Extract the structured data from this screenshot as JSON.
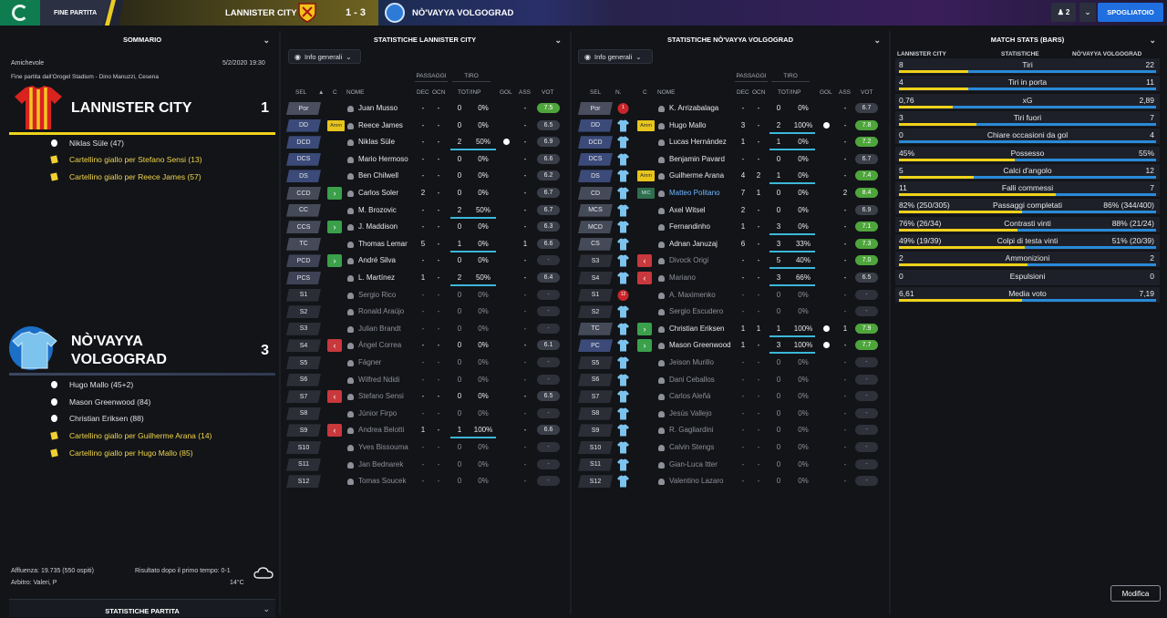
{
  "topbar": {
    "status": "FINE PARTITA",
    "home_team": "LANNISTER CITY",
    "score": "1 - 3",
    "away_team": "NÒ'VAYYA VOLGOGRAD",
    "user_count": "2",
    "spogliatoio": "SPOGLIATOIO",
    "colors": {
      "home_accent": "#e8cc25",
      "primary_button": "#1f6fe0"
    }
  },
  "summary": {
    "header": "SOMMARIO",
    "competition": "Amichevole",
    "datetime": "5/2/2020 19:30",
    "stadium": "Fine partita dall'Orogel Stadium - Dino Manuzzi, Cesena",
    "home": {
      "name": "LANNISTER CITY",
      "goals": "1",
      "events": [
        {
          "type": "goal",
          "text": "Niklas Süle (47)"
        },
        {
          "type": "yellow",
          "text": "Cartellino giallo per Stefano Sensi (13)"
        },
        {
          "type": "yellow",
          "text": "Cartellino giallo per Reece James (57)"
        }
      ]
    },
    "away": {
      "name_line1": "NÒ'VAYYA",
      "name_line2": "VOLGOGRAD",
      "goals": "3",
      "events": [
        {
          "type": "goal",
          "text": "Hugo Mallo (45+2)"
        },
        {
          "type": "goal",
          "text": "Mason Greenwood (84)"
        },
        {
          "type": "goal",
          "text": "Christian Eriksen (88)"
        },
        {
          "type": "yellow",
          "text": "Cartellino giallo per Guilherme Arana (14)"
        },
        {
          "type": "yellow",
          "text": "Cartellino giallo per Hugo Mallo (85)"
        }
      ]
    },
    "attendance": "Affluenza: 19.735 (550 ospiti)",
    "referee": "Arbitro: Valeri, P",
    "halftime": "Risultato dopo il primo tempo: 0-1",
    "temperature": "14°C",
    "bottom_section": "STATISTICHE PARTITA"
  },
  "home_stats": {
    "header": "STATISTICHE LANNISTER CITY",
    "filter": "Info generali",
    "groups": {
      "passaggi": "PASSAGGI",
      "tiro": "TIRO"
    },
    "columns": {
      "sel": "SEL",
      "c": "C",
      "nome": "NOME",
      "dec": "DEC",
      "ocn": "OCN",
      "totinp": "TOT/INP",
      "gol": "GOL",
      "ass": "ASS",
      "vot": "VOT"
    },
    "rows": [
      {
        "pos": "Por",
        "kind": "gk",
        "name": "Juan Musso",
        "sub": false,
        "dec": "-",
        "ocn": "-",
        "tot": "0",
        "pct": "0%",
        "gol": "",
        "ass": "-",
        "vot": "7.5",
        "vot_style": "green",
        "badge": ""
      },
      {
        "pos": "DD",
        "kind": "def",
        "name": "Reece James",
        "sub": false,
        "dec": "-",
        "ocn": "-",
        "tot": "0",
        "pct": "0%",
        "gol": "",
        "ass": "-",
        "vot": "6.5",
        "vot_style": "",
        "badge": "Amm"
      },
      {
        "pos": "DCD",
        "kind": "def",
        "name": "Niklas Süle",
        "sub": false,
        "dec": "-",
        "ocn": "-",
        "tot": "2",
        "pct": "50%",
        "gol": "ball",
        "ass": "-",
        "vot": "6.9",
        "vot_style": "",
        "badge": ""
      },
      {
        "pos": "DCS",
        "kind": "def",
        "name": "Mario Hermoso",
        "sub": false,
        "dec": "-",
        "ocn": "-",
        "tot": "0",
        "pct": "0%",
        "gol": "",
        "ass": "-",
        "vot": "6.6",
        "vot_style": "",
        "badge": ""
      },
      {
        "pos": "DS",
        "kind": "def",
        "name": "Ben Chilwell",
        "sub": false,
        "dec": "-",
        "ocn": "-",
        "tot": "0",
        "pct": "0%",
        "gol": "",
        "ass": "-",
        "vot": "6.2",
        "vot_style": "",
        "badge": ""
      },
      {
        "pos": "CCD",
        "kind": "mid",
        "name": "Carlos Soler",
        "sub": false,
        "dec": "2",
        "ocn": "-",
        "tot": "0",
        "pct": "0%",
        "gol": "",
        "ass": "-",
        "vot": "6.7",
        "vot_style": "",
        "badge": "in"
      },
      {
        "pos": "CC",
        "kind": "mid",
        "name": "M. Brozovic",
        "sub": false,
        "dec": "-",
        "ocn": "-",
        "tot": "2",
        "pct": "50%",
        "gol": "",
        "ass": "-",
        "vot": "6.7",
        "vot_style": "",
        "badge": ""
      },
      {
        "pos": "CCS",
        "kind": "mid",
        "name": "J. Maddison",
        "sub": false,
        "dec": "-",
        "ocn": "-",
        "tot": "0",
        "pct": "0%",
        "gol": "",
        "ass": "-",
        "vot": "6.3",
        "vot_style": "",
        "badge": "in"
      },
      {
        "pos": "TC",
        "kind": "mid",
        "name": "Thomas Lemar",
        "sub": false,
        "dec": "5",
        "ocn": "-",
        "tot": "1",
        "pct": "0%",
        "gol": "",
        "ass": "1",
        "vot": "6.6",
        "vot_style": "",
        "badge": ""
      },
      {
        "pos": "PCD",
        "kind": "start",
        "name": "André Silva",
        "sub": false,
        "dec": "-",
        "ocn": "-",
        "tot": "0",
        "pct": "0%",
        "gol": "",
        "ass": "-",
        "vot": "-",
        "vot_style": "dash",
        "badge": "in"
      },
      {
        "pos": "PCS",
        "kind": "start",
        "name": "L. Martínez",
        "sub": false,
        "dec": "1",
        "ocn": "-",
        "tot": "2",
        "pct": "50%",
        "gol": "",
        "ass": "-",
        "vot": "6.4",
        "vot_style": "",
        "badge": ""
      },
      {
        "pos": "S1",
        "kind": "sub",
        "name": "Sergio Rico",
        "sub": true,
        "dec": "-",
        "ocn": "-",
        "tot": "0",
        "pct": "0%",
        "gol": "",
        "ass": "-",
        "vot": "-",
        "vot_style": "dash",
        "badge": ""
      },
      {
        "pos": "S2",
        "kind": "sub",
        "name": "Ronald Araújo",
        "sub": true,
        "dec": "-",
        "ocn": "-",
        "tot": "0",
        "pct": "0%",
        "gol": "",
        "ass": "-",
        "vot": "-",
        "vot_style": "dash",
        "badge": ""
      },
      {
        "pos": "S3",
        "kind": "sub",
        "name": "Julian Brandt",
        "sub": true,
        "dec": "-",
        "ocn": "-",
        "tot": "0",
        "pct": "0%",
        "gol": "",
        "ass": "-",
        "vot": "-",
        "vot_style": "dash",
        "badge": ""
      },
      {
        "pos": "S4",
        "kind": "sub",
        "name": "Ángel Correa",
        "sub": true,
        "dec": "-",
        "ocn": "-",
        "tot": "0",
        "pct": "0%",
        "gol": "",
        "ass": "-",
        "vot": "6.1",
        "vot_style": "",
        "badge": "out"
      },
      {
        "pos": "S5",
        "kind": "sub",
        "name": "Fágner",
        "sub": true,
        "dec": "-",
        "ocn": "-",
        "tot": "0",
        "pct": "0%",
        "gol": "",
        "ass": "-",
        "vot": "-",
        "vot_style": "dash",
        "badge": ""
      },
      {
        "pos": "S6",
        "kind": "sub",
        "name": "Wilfred Ndidi",
        "sub": true,
        "dec": "-",
        "ocn": "-",
        "tot": "0",
        "pct": "0%",
        "gol": "",
        "ass": "-",
        "vot": "-",
        "vot_style": "dash",
        "badge": ""
      },
      {
        "pos": "S7",
        "kind": "sub",
        "name": "Stefano Sensi",
        "sub": true,
        "dec": "-",
        "ocn": "-",
        "tot": "0",
        "pct": "0%",
        "gol": "",
        "ass": "-",
        "vot": "6.5",
        "vot_style": "",
        "badge": "out"
      },
      {
        "pos": "S8",
        "kind": "sub",
        "name": "Júnior Firpo",
        "sub": true,
        "dec": "-",
        "ocn": "-",
        "tot": "0",
        "pct": "0%",
        "gol": "",
        "ass": "-",
        "vot": "-",
        "vot_style": "dash",
        "badge": ""
      },
      {
        "pos": "S9",
        "kind": "sub",
        "name": "Andrea Belotti",
        "sub": true,
        "dec": "1",
        "ocn": "-",
        "tot": "1",
        "pct": "100%",
        "gol": "",
        "ass": "-",
        "vot": "6.6",
        "vot_style": "",
        "badge": "out"
      },
      {
        "pos": "S10",
        "kind": "sub",
        "name": "Yves Bissouma",
        "sub": true,
        "dec": "-",
        "ocn": "-",
        "tot": "0",
        "pct": "0%",
        "gol": "",
        "ass": "-",
        "vot": "-",
        "vot_style": "dash",
        "badge": ""
      },
      {
        "pos": "S11",
        "kind": "sub",
        "name": "Jan Bednarek",
        "sub": true,
        "dec": "-",
        "ocn": "-",
        "tot": "0",
        "pct": "0%",
        "gol": "",
        "ass": "-",
        "vot": "-",
        "vot_style": "dash",
        "badge": ""
      },
      {
        "pos": "S12",
        "kind": "sub",
        "name": "Tomas Soucek",
        "sub": true,
        "dec": "-",
        "ocn": "-",
        "tot": "0",
        "pct": "0%",
        "gol": "",
        "ass": "-",
        "vot": "-",
        "vot_style": "dash",
        "badge": ""
      }
    ]
  },
  "away_stats": {
    "header": "STATISTICHE NÒ'VAYYA VOLGOGRAD",
    "filter": "Info generali",
    "groups": {
      "passaggi": "PASSAGGI",
      "tiro": "TIRO"
    },
    "columns": {
      "sel": "SEL",
      "n": "N.",
      "c": "C",
      "nome": "NOME",
      "dec": "DEC",
      "ocn": "OCN",
      "totinp": "TOT/INP",
      "gol": "GOL",
      "ass": "ASS",
      "vot": "VOT"
    },
    "rows": [
      {
        "pos": "Por",
        "kind": "gk",
        "num": "1",
        "name": "K. Arrizabalaga",
        "hl": false,
        "sub": false,
        "dec": "-",
        "ocn": "-",
        "tot": "0",
        "pct": "0%",
        "gol": "",
        "ass": "-",
        "vot": "6.7",
        "vot_style": "",
        "badge": ""
      },
      {
        "pos": "DD",
        "kind": "def",
        "num": "",
        "name": "Hugo Mallo",
        "hl": false,
        "sub": false,
        "dec": "3",
        "ocn": "-",
        "tot": "2",
        "pct": "100%",
        "gol": "ball",
        "ass": "-",
        "vot": "7.8",
        "vot_style": "green",
        "badge": "Amm"
      },
      {
        "pos": "DCD",
        "kind": "def",
        "num": "",
        "name": "Lucas Hernández",
        "hl": false,
        "sub": false,
        "dec": "1",
        "ocn": "-",
        "tot": "1",
        "pct": "0%",
        "gol": "",
        "ass": "-",
        "vot": "7.2",
        "vot_style": "green",
        "badge": ""
      },
      {
        "pos": "DCS",
        "kind": "def",
        "num": "",
        "name": "Benjamin Pavard",
        "hl": false,
        "sub": false,
        "dec": "-",
        "ocn": "-",
        "tot": "0",
        "pct": "0%",
        "gol": "",
        "ass": "-",
        "vot": "6.7",
        "vot_style": "",
        "badge": ""
      },
      {
        "pos": "DS",
        "kind": "def",
        "num": "",
        "name": "Guilherme Arana",
        "hl": false,
        "sub": false,
        "dec": "4",
        "ocn": "2",
        "tot": "1",
        "pct": "0%",
        "gol": "",
        "ass": "-",
        "vot": "7.4",
        "vot_style": "green",
        "badge": "Amm"
      },
      {
        "pos": "CD",
        "kind": "mid",
        "num": "",
        "name": "Matteo Politano",
        "hl": true,
        "sub": false,
        "dec": "7",
        "ocn": "1",
        "tot": "0",
        "pct": "0%",
        "gol": "",
        "ass": "2",
        "vot": "8.4",
        "vot_style": "green",
        "badge": "MIC"
      },
      {
        "pos": "MCS",
        "kind": "mid",
        "num": "",
        "name": "Axel Witsel",
        "hl": false,
        "sub": false,
        "dec": "2",
        "ocn": "-",
        "tot": "0",
        "pct": "0%",
        "gol": "",
        "ass": "-",
        "vot": "6.9",
        "vot_style": "",
        "badge": ""
      },
      {
        "pos": "MCD",
        "kind": "mid",
        "num": "",
        "name": "Fernandinho",
        "hl": false,
        "sub": false,
        "dec": "1",
        "ocn": "-",
        "tot": "3",
        "pct": "0%",
        "gol": "",
        "ass": "-",
        "vot": "7.1",
        "vot_style": "green",
        "badge": ""
      },
      {
        "pos": "CS",
        "kind": "mid",
        "num": "",
        "name": "Adnan Januzaj",
        "hl": false,
        "sub": false,
        "dec": "6",
        "ocn": "-",
        "tot": "3",
        "pct": "33%",
        "gol": "",
        "ass": "-",
        "vot": "7.3",
        "vot_style": "green",
        "badge": ""
      },
      {
        "pos": "S3",
        "kind": "sub",
        "num": "",
        "name": "Divock Origi",
        "hl": false,
        "sub": true,
        "dec": "-",
        "ocn": "-",
        "tot": "5",
        "pct": "40%",
        "gol": "",
        "ass": "-",
        "vot": "7.0",
        "vot_style": "green",
        "badge": "out"
      },
      {
        "pos": "S4",
        "kind": "sub",
        "num": "",
        "name": "Mariano",
        "hl": false,
        "sub": true,
        "dec": "-",
        "ocn": "-",
        "tot": "3",
        "pct": "66%",
        "gol": "",
        "ass": "-",
        "vot": "6.5",
        "vot_style": "",
        "badge": "out"
      },
      {
        "pos": "S1",
        "kind": "sub",
        "num": "12",
        "name": "A. Maximenko",
        "hl": false,
        "sub": true,
        "dec": "-",
        "ocn": "-",
        "tot": "0",
        "pct": "0%",
        "gol": "",
        "ass": "-",
        "vot": "-",
        "vot_style": "dash",
        "badge": ""
      },
      {
        "pos": "S2",
        "kind": "sub",
        "num": "",
        "name": "Sergio Escudero",
        "hl": false,
        "sub": true,
        "dec": "-",
        "ocn": "-",
        "tot": "0",
        "pct": "0%",
        "gol": "",
        "ass": "-",
        "vot": "-",
        "vot_style": "dash",
        "badge": ""
      },
      {
        "pos": "TC",
        "kind": "mid",
        "num": "",
        "name": "Christian Eriksen",
        "hl": false,
        "sub": false,
        "dec": "1",
        "ocn": "1",
        "tot": "1",
        "pct": "100%",
        "gol": "ball",
        "ass": "1",
        "vot": "7.9",
        "vot_style": "green",
        "badge": "in"
      },
      {
        "pos": "PC",
        "kind": "def",
        "num": "",
        "name": "Mason Greenwood",
        "hl": false,
        "sub": false,
        "dec": "1",
        "ocn": "-",
        "tot": "3",
        "pct": "100%",
        "gol": "ball",
        "ass": "-",
        "vot": "7.7",
        "vot_style": "green",
        "badge": "in"
      },
      {
        "pos": "S5",
        "kind": "sub",
        "num": "",
        "name": "Jeison Murillo",
        "hl": false,
        "sub": true,
        "dec": "-",
        "ocn": "-",
        "tot": "0",
        "pct": "0%",
        "gol": "",
        "ass": "-",
        "vot": "-",
        "vot_style": "dash",
        "badge": ""
      },
      {
        "pos": "S6",
        "kind": "sub",
        "num": "",
        "name": "Dani Ceballos",
        "hl": false,
        "sub": true,
        "dec": "-",
        "ocn": "-",
        "tot": "0",
        "pct": "0%",
        "gol": "",
        "ass": "-",
        "vot": "-",
        "vot_style": "dash",
        "badge": ""
      },
      {
        "pos": "S7",
        "kind": "sub",
        "num": "",
        "name": "Carlos Aleñá",
        "hl": false,
        "sub": true,
        "dec": "-",
        "ocn": "-",
        "tot": "0",
        "pct": "0%",
        "gol": "",
        "ass": "-",
        "vot": "-",
        "vot_style": "dash",
        "badge": ""
      },
      {
        "pos": "S8",
        "kind": "sub",
        "num": "",
        "name": "Jesús Vallejo",
        "hl": false,
        "sub": true,
        "dec": "-",
        "ocn": "-",
        "tot": "0",
        "pct": "0%",
        "gol": "",
        "ass": "-",
        "vot": "-",
        "vot_style": "dash",
        "badge": ""
      },
      {
        "pos": "S9",
        "kind": "sub",
        "num": "",
        "name": "R. Gagliardini",
        "hl": false,
        "sub": true,
        "dec": "-",
        "ocn": "-",
        "tot": "0",
        "pct": "0%",
        "gol": "",
        "ass": "-",
        "vot": "-",
        "vot_style": "dash",
        "badge": ""
      },
      {
        "pos": "S10",
        "kind": "sub",
        "num": "",
        "name": "Calvin Stengs",
        "hl": false,
        "sub": true,
        "dec": "-",
        "ocn": "-",
        "tot": "0",
        "pct": "0%",
        "gol": "",
        "ass": "-",
        "vot": "-",
        "vot_style": "dash",
        "badge": ""
      },
      {
        "pos": "S11",
        "kind": "sub",
        "num": "",
        "name": "Gian-Luca Itter",
        "hl": false,
        "sub": true,
        "dec": "-",
        "ocn": "-",
        "tot": "0",
        "pct": "0%",
        "gol": "",
        "ass": "-",
        "vot": "-",
        "vot_style": "dash",
        "badge": ""
      },
      {
        "pos": "S12",
        "kind": "sub",
        "num": "",
        "name": "Valentino Lazaro",
        "hl": false,
        "sub": true,
        "dec": "-",
        "ocn": "-",
        "tot": "0",
        "pct": "0%",
        "gol": "",
        "ass": "-",
        "vot": "-",
        "vot_style": "dash",
        "badge": ""
      }
    ]
  },
  "match_bars": {
    "header": "MATCH STATS (BARS)",
    "col_home": "LANNISTER CITY",
    "col_mid": "STATISTICHE",
    "col_away": "NÒ'VAYYA VOLGOGRAD",
    "rows": [
      {
        "label": "Tiri",
        "home": "8",
        "away": "22",
        "home_frac": 0.27,
        "away_frac": 0.73
      },
      {
        "label": "Tiri in porta",
        "home": "4",
        "away": "11",
        "home_frac": 0.27,
        "away_frac": 0.73
      },
      {
        "label": "xG",
        "home": "0,76",
        "away": "2,89",
        "home_frac": 0.21,
        "away_frac": 0.79
      },
      {
        "label": "Tiri fuori",
        "home": "3",
        "away": "7",
        "home_frac": 0.3,
        "away_frac": 0.7
      },
      {
        "label": "Chiare occasioni da gol",
        "home": "0",
        "away": "4",
        "home_frac": 0.0,
        "away_frac": 1.0
      },
      {
        "label": "Possesso",
        "home": "45%",
        "away": "55%",
        "home_frac": 0.45,
        "away_frac": 0.55
      },
      {
        "label": "Calci d'angolo",
        "home": "5",
        "away": "12",
        "home_frac": 0.29,
        "away_frac": 0.71
      },
      {
        "label": "Falli commessi",
        "home": "11",
        "away": "7",
        "home_frac": 0.61,
        "away_frac": 0.39
      },
      {
        "label": "Passaggi completati",
        "home": "82% (250/305)",
        "away": "86% (344/400)",
        "home_frac": 0.48,
        "away_frac": 0.52
      },
      {
        "label": "Contrasti vinti",
        "home": "76% (26/34)",
        "away": "88% (21/24)",
        "home_frac": 0.46,
        "away_frac": 0.54
      },
      {
        "label": "Colpi di testa vinti",
        "home": "49% (19/39)",
        "away": "51% (20/39)",
        "home_frac": 0.49,
        "away_frac": 0.51
      },
      {
        "label": "Ammonizioni",
        "home": "2",
        "away": "2",
        "home_frac": 0.5,
        "away_frac": 0.5
      },
      {
        "label": "Espulsioni",
        "home": "0",
        "away": "0",
        "home_frac": 0.0,
        "away_frac": 0.0
      },
      {
        "label": "Media voto",
        "home": "6,61",
        "away": "7,19",
        "home_frac": 0.48,
        "away_frac": 0.52
      }
    ],
    "modifica": "Modifica"
  }
}
